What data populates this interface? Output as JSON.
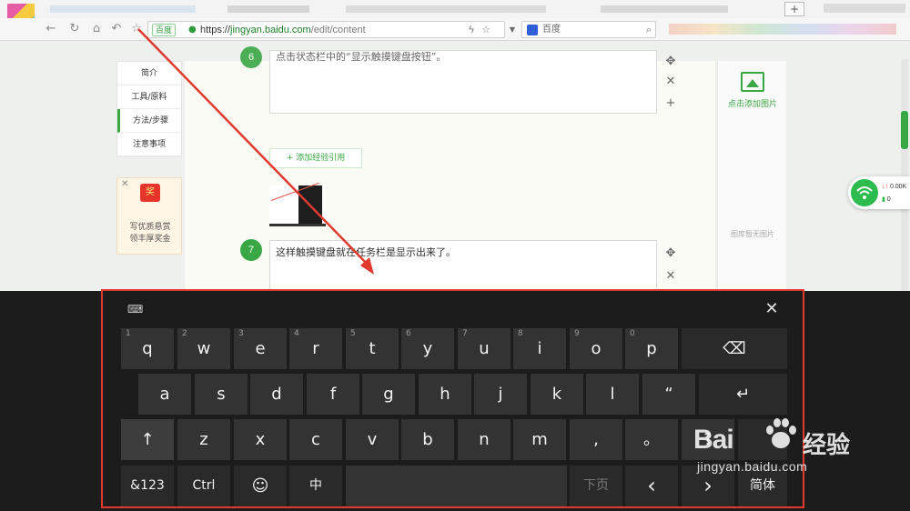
{
  "browser": {
    "address_badge": "百度",
    "url_scheme": "https://",
    "url_host": "jingyan.baidu.com",
    "url_path": "/edit/content",
    "search_placeholder": "百度",
    "new_tab": "+"
  },
  "left_nav": {
    "items": [
      {
        "label": "简介"
      },
      {
        "label": "工具/原料"
      },
      {
        "label": "方法/步骤",
        "active": true
      },
      {
        "label": "注意事项"
      }
    ]
  },
  "ad": {
    "tag": "奖",
    "text_line1": "写优质悬赏",
    "text_line2": "领丰厚奖金"
  },
  "editor": {
    "prev_step_text": "点击状态栏中的“显示触摸键盘按钮”。",
    "add_reference": "+ 添加经验引用",
    "step7": {
      "number": "7",
      "text": "这样触摸键盘就在任务栏是显示出来了。"
    }
  },
  "right_panel": {
    "add_picture": "点击添加图片",
    "empty": "图库暂无图片"
  },
  "net_widget": {
    "up": "0.00K",
    "down": "0"
  },
  "keyboard": {
    "row1": [
      {
        "label": "q",
        "num": "1"
      },
      {
        "label": "w",
        "num": "2"
      },
      {
        "label": "e",
        "num": "3"
      },
      {
        "label": "r",
        "num": "4"
      },
      {
        "label": "t",
        "num": "5"
      },
      {
        "label": "y",
        "num": "6"
      },
      {
        "label": "u",
        "num": "7"
      },
      {
        "label": "i",
        "num": "8"
      },
      {
        "label": "o",
        "num": "9"
      },
      {
        "label": "p",
        "num": "0"
      }
    ],
    "backspace": "⌫",
    "row2": [
      "a",
      "s",
      "d",
      "f",
      "g",
      "h",
      "j",
      "k",
      "l",
      "“"
    ],
    "enter": "↵",
    "shift": "↑",
    "row3": [
      "z",
      "x",
      "c",
      "v",
      "b",
      "n",
      "m",
      ",",
      "。",
      "?"
    ],
    "numbers": "&123",
    "ctrl": "Ctrl",
    "emoji": "☺",
    "ime": "中",
    "page_down": "下页",
    "left": "‹",
    "right": "›",
    "lang": "简体"
  },
  "watermark": {
    "brand": "Bai",
    "brand_cn": "经验",
    "url": "jingyan.baidu.com"
  },
  "colors": {
    "accent": "#3aa745",
    "highlight": "#e03a2f",
    "keyboard_bg": "#1c1c1c",
    "key_bg": "#333333"
  }
}
